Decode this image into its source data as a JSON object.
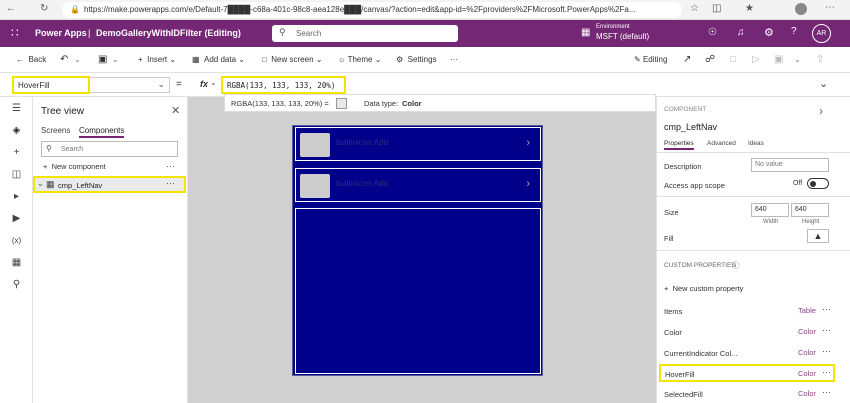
{
  "browser": {
    "url": "https://make.powerapps.com/e/Default-7████-c68a-401c-98c8-aea128e███/canvas/?action=edit&app-id=%2Fproviders%2FMicrosoft.PowerApps%2Fa..."
  },
  "appbar": {
    "product": "Power Apps",
    "separator": "|",
    "app_name": "DemoGalleryWithIDFilter (Editing)",
    "search_placeholder": "Search",
    "env_label": "Environment",
    "env_name": "MSFT (default)",
    "avatar": "AR"
  },
  "commandbar": {
    "back": "Back",
    "insert": "Insert",
    "add_data": "Add data",
    "new_screen": "New screen",
    "theme": "Theme",
    "settings": "Settings",
    "more": "···",
    "editing": "Editing"
  },
  "formula": {
    "property": "HoverFill",
    "equals": "=",
    "fx": "fx",
    "value": "RGBA(133, 133, 133, 20%)",
    "preview": "RGBA(133, 133, 133, 20%) =",
    "datatype_label": "Data type:",
    "datatype_value": "Color"
  },
  "tree": {
    "title": "Tree view",
    "tab_screens": "Screens",
    "tab_components": "Components",
    "search_placeholder": "Search",
    "new_component": "New component",
    "item": "cmp_LeftNav"
  },
  "canvas": {
    "rows": [
      {
        "text": "builtinicon:Add"
      },
      {
        "text": "builtinicon:Add"
      }
    ]
  },
  "rightpane": {
    "type_label": "COMPONENT",
    "name": "cmp_LeftNav",
    "tabs": [
      "Properties",
      "Advanced",
      "Ideas"
    ],
    "description_label": "Description",
    "description_value": "No value",
    "access_label": "Access app scope",
    "access_value": "Off",
    "size_label": "Size",
    "width": "640",
    "height": "640",
    "width_label": "Width",
    "height_label": "Height",
    "fill_label": "Fill",
    "custom_header": "CUSTOM PROPERTIES",
    "new_custom": "New custom property",
    "custom": [
      {
        "name": "Items",
        "type": "Table"
      },
      {
        "name": "Color",
        "type": "Color"
      },
      {
        "name": "CurrentIndicator Col...",
        "type": "Color"
      },
      {
        "name": "HoverFill",
        "type": "Color"
      },
      {
        "name": "SelectedFill",
        "type": "Color"
      }
    ]
  },
  "colors": {
    "appbar": "#742774",
    "gallery": "#00008b",
    "highlight": "#f2e600",
    "canvas_bg": "#d0d0d0"
  }
}
